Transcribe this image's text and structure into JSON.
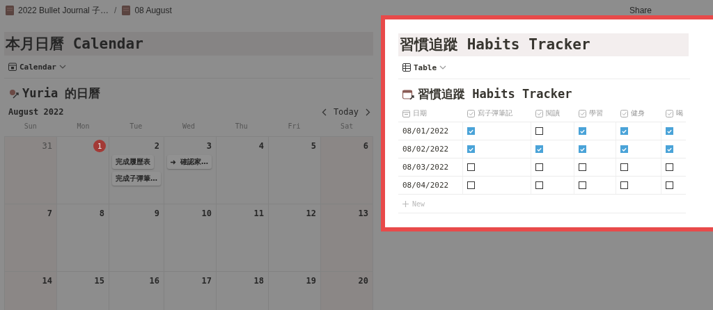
{
  "breadcrumb": [
    {
      "label": "2022 Bullet Journal 子…"
    },
    {
      "separator": "/",
      "label": "08 August"
    }
  ],
  "topbar": {
    "share": "Share"
  },
  "calendar_page": {
    "title": "本月日曆 Calendar",
    "view": "Calendar",
    "heading": "Yuria 的日曆",
    "month": "August 2022",
    "today_button": "Today",
    "weekdays": [
      "Sun",
      "Mon",
      "Tue",
      "Wed",
      "Thu",
      "Fri",
      "Sat"
    ],
    "weeks": [
      [
        {
          "day": "31",
          "outside": true,
          "today": false
        },
        {
          "day": "1",
          "outside": false,
          "today": true
        },
        {
          "day": "2",
          "outside": false,
          "today": false,
          "events": [
            {
              "text": "完成履歷表",
              "arrow": false
            },
            {
              "text": "完成子彈筆…",
              "arrow": false
            }
          ]
        },
        {
          "day": "3",
          "outside": false,
          "today": false,
          "events": [
            {
              "text": "確認家…",
              "arrow": true
            }
          ]
        },
        {
          "day": "4",
          "outside": false,
          "today": false
        },
        {
          "day": "5",
          "outside": false,
          "today": false
        },
        {
          "day": "6",
          "outside": false,
          "today": false
        }
      ],
      [
        {
          "day": "7",
          "outside": false,
          "today": false
        },
        {
          "day": "8",
          "outside": false,
          "today": false
        },
        {
          "day": "9",
          "outside": false,
          "today": false
        },
        {
          "day": "10",
          "outside": false,
          "today": false
        },
        {
          "day": "11",
          "outside": false,
          "today": false
        },
        {
          "day": "12",
          "outside": false,
          "today": false
        },
        {
          "day": "13",
          "outside": false,
          "today": false
        }
      ],
      [
        {
          "day": "14",
          "outside": false,
          "today": false
        },
        {
          "day": "15",
          "outside": false,
          "today": false
        },
        {
          "day": "16",
          "outside": false,
          "today": false
        },
        {
          "day": "17",
          "outside": false,
          "today": false
        },
        {
          "day": "18",
          "outside": false,
          "today": false
        },
        {
          "day": "19",
          "outside": false,
          "today": false
        },
        {
          "day": "20",
          "outside": false,
          "today": false
        }
      ]
    ]
  },
  "tracker": {
    "title": "習慣追蹤 Habits Tracker",
    "view": "Table",
    "heading": "習慣追蹤 Habits Tracker",
    "columns": [
      {
        "label": "日期",
        "kind": "date"
      },
      {
        "label": "寫子彈筆記",
        "kind": "checkbox"
      },
      {
        "label": "閱讀",
        "kind": "checkbox"
      },
      {
        "label": "學習",
        "kind": "checkbox"
      },
      {
        "label": "健身",
        "kind": "checkbox"
      },
      {
        "label": "喝",
        "kind": "checkbox"
      }
    ],
    "rows": [
      {
        "date": "08/01/2022",
        "checks": [
          true,
          false,
          true,
          true,
          true
        ]
      },
      {
        "date": "08/02/2022",
        "checks": [
          true,
          true,
          true,
          true,
          true
        ]
      },
      {
        "date": "08/03/2022",
        "checks": [
          false,
          false,
          false,
          false,
          false
        ]
      },
      {
        "date": "08/04/2022",
        "checks": [
          false,
          false,
          false,
          false,
          false
        ]
      }
    ],
    "new_label": "New"
  }
}
